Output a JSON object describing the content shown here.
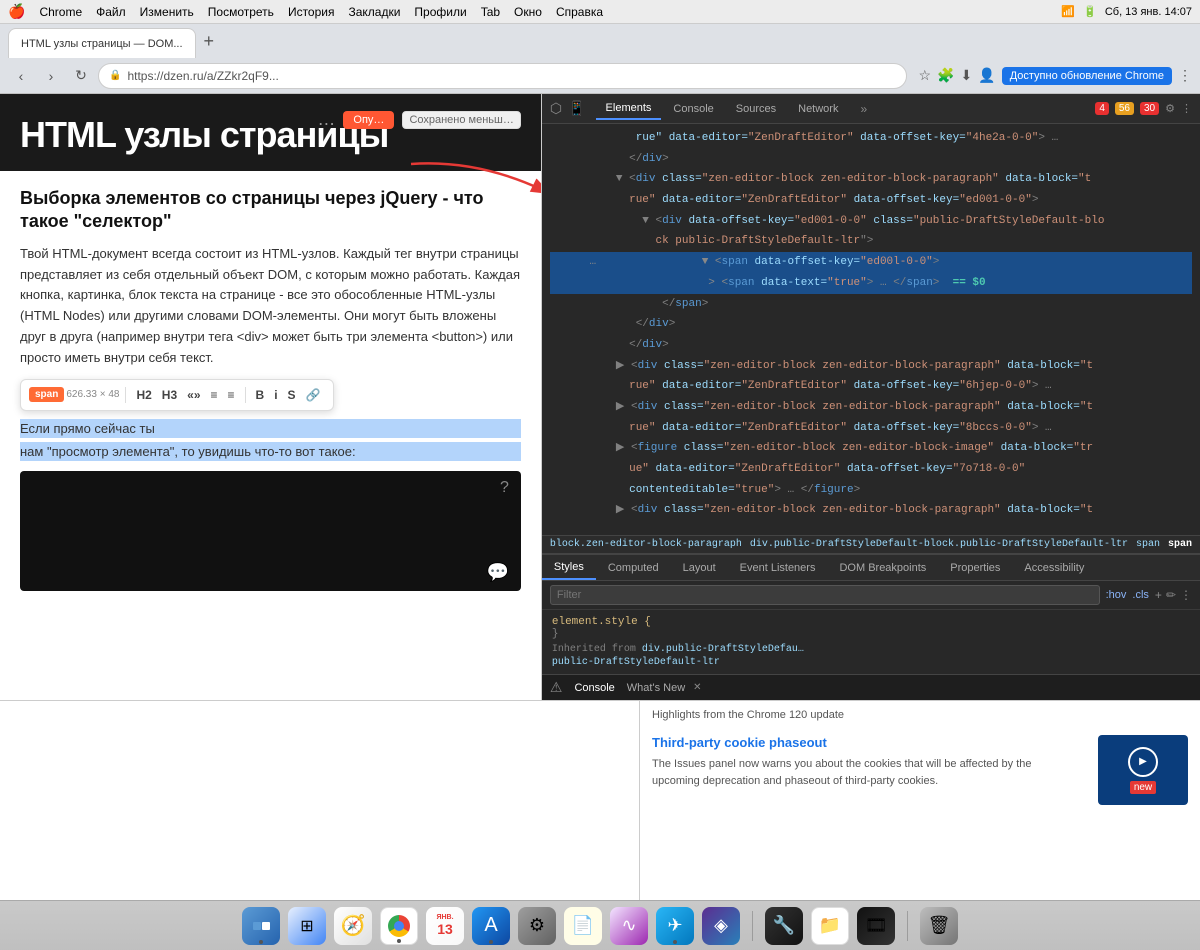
{
  "menubar": {
    "apple": "⌘",
    "items": [
      "Chrome",
      "Файл",
      "Изменить",
      "Посмотреть",
      "История",
      "Закладки",
      "Профили",
      "Tab",
      "Окно",
      "Справка"
    ],
    "time": "Сб, 13 янв. 14:07"
  },
  "toolbar": {
    "address": "https://dzen.ru/a/ZZkr2qF9...",
    "update_text": "Доступно обновление Chrome"
  },
  "tabs": [
    {
      "label": "HTML узлы страницы — DOM...",
      "active": true
    }
  ],
  "webpage": {
    "header_title": "HTML узлы страницы",
    "dots": "…",
    "saved_text": "Сохранено меньш…",
    "article_title": "Выборка элементов со страницы через jQuery - что такое \"селектор\"",
    "article_body": "Твой HTML-документ всегда состоит из HTML-узлов. Каждый тег внутри страницы представляет из себя отдельный объект DOM, с которым можно работать. Каждая кнопка, картинка, блок текста на странице - все это обособленные HTML-узлы (HTML Nodes) или другими словами DOM-элементы. Они могут быть вложены друг в друга (например внутри тега <div> может быть три элемента <button>) или просто иметь внутри себя текст.",
    "span_label": "span",
    "span_size": "626.33 × 48",
    "toolbar_h2": "H2",
    "toolbar_h3": "H3",
    "toolbar_guillemets": "«»",
    "toolbar_list1": "≡",
    "toolbar_list2": "≡",
    "toolbar_bold": "B",
    "toolbar_italic": "i",
    "toolbar_strike": "S",
    "toolbar_link": "🔗",
    "highlight1": "Если прямо сейчас ты",
    "highlight2": "нам \"просмотр элемента\", то увидишь что-то вот такое:"
  },
  "devtools": {
    "tabs": [
      "Elements",
      "Console",
      "Sources",
      "Network",
      "»"
    ],
    "badges": {
      "red": "4",
      "yellow": "56",
      "orange": "30"
    },
    "html_tree": [
      {
        "indent": 0,
        "content": "rue\" data-editor=\"ZenDraftEditor\" data-offset-key=\"4he2a-0-0\"> …"
      },
      {
        "indent": 0,
        "content": "</div>"
      },
      {
        "indent": 0,
        "content": "<div class=\"zen-editor-block zen-editor-block-paragraph\" data-block=\"t"
      },
      {
        "indent": 1,
        "content": "rue\" data-editor=\"ZenDraftEditor\" data-offset-key=\"ed001-0-0\">"
      },
      {
        "indent": 2,
        "content": "<div data-offset-key=\"ed001-0-0\" class=\"public-DraftStyleDefault-blo"
      },
      {
        "indent": 3,
        "content": "ck public-DraftStyleDefault-ltr\">"
      },
      {
        "indent": 4,
        "content": "<span data-offset-key=\"ed00l-0-0\">",
        "selected": true
      },
      {
        "indent": 5,
        "content": "<span data-text=\"true\"> … </span>  == $0",
        "selected": true,
        "is_active": true
      },
      {
        "indent": 4,
        "content": "</span>"
      },
      {
        "indent": 3,
        "content": "</div>"
      },
      {
        "indent": 2,
        "content": "</div>"
      },
      {
        "indent": 0,
        "content": "<div class=\"zen-editor-block zen-editor-block-paragraph\" data-block=\"t"
      },
      {
        "indent": 1,
        "content": "rue\" data-editor=\"ZenDraftEditor\" data-offset-key=\"6hjep-0-0\"> …"
      },
      {
        "indent": 0,
        "content": "<div class=\"zen-editor-block zen-editor-block-paragraph\" data-block=\"t"
      },
      {
        "indent": 1,
        "content": "rue\" data-editor=\"ZenDraftEditor\" data-offset-key=\"8bccs-0-0\"> …"
      },
      {
        "indent": 0,
        "content": "<figure class=\"zen-editor-block zen-editor-block-image\" data-block=\"tr"
      },
      {
        "indent": 1,
        "content": "ue\" data-editor=\"ZenDraftEditor\" data-offset-key=\"7o718-0-0\""
      },
      {
        "indent": 2,
        "content": "contenteditable=\"true\"> … </figure>"
      },
      {
        "indent": 0,
        "content": "<div class=\"zen-editor-block zen-editor-block-paragraph\" data-block=\"t"
      }
    ],
    "breadcrumb": [
      "block.zen-editor-block-paragraph",
      "div.public-DraftStyleDefault-block.public-DraftStyleDefault-ltr",
      "span",
      "span"
    ],
    "styles_tabs": [
      "Styles",
      "Computed",
      "Layout",
      "Event Listeners",
      "DOM Breakpoints",
      "Properties",
      "Accessibility"
    ],
    "filter_placeholder": "Filter",
    "filter_hov": ":hov",
    "filter_cls": ".cls",
    "element_style": "element.style {",
    "element_style_close": "}",
    "inherited_from": "Inherited from",
    "inherited_class": "div.public-DraftStyleDefau…",
    "inherited_class2": "public-DraftStyleDefault-ltr"
  },
  "console_bar": {
    "console_label": "Console",
    "whatsnew_label": "What's New",
    "highlights_text": "Highlights from the Chrome 120 update"
  },
  "bottom_panel": {
    "news_title": "Third-party cookie phaseout",
    "news_text": "The Issues panel now warns you about the cookies that will be affected by the upcoming deprecation and phaseout of third-party cookies.",
    "thumbnail_text": "new"
  },
  "dock": {
    "date_month": "ЯНВ.",
    "date_day": "13",
    "icons": [
      "🖥",
      "⊞",
      "🧭",
      "🌐",
      "📅",
      "🏪",
      "⚙",
      "📄",
      "🌊",
      "✈",
      "💜",
      "🔧",
      "📁",
      "🗑"
    ]
  }
}
